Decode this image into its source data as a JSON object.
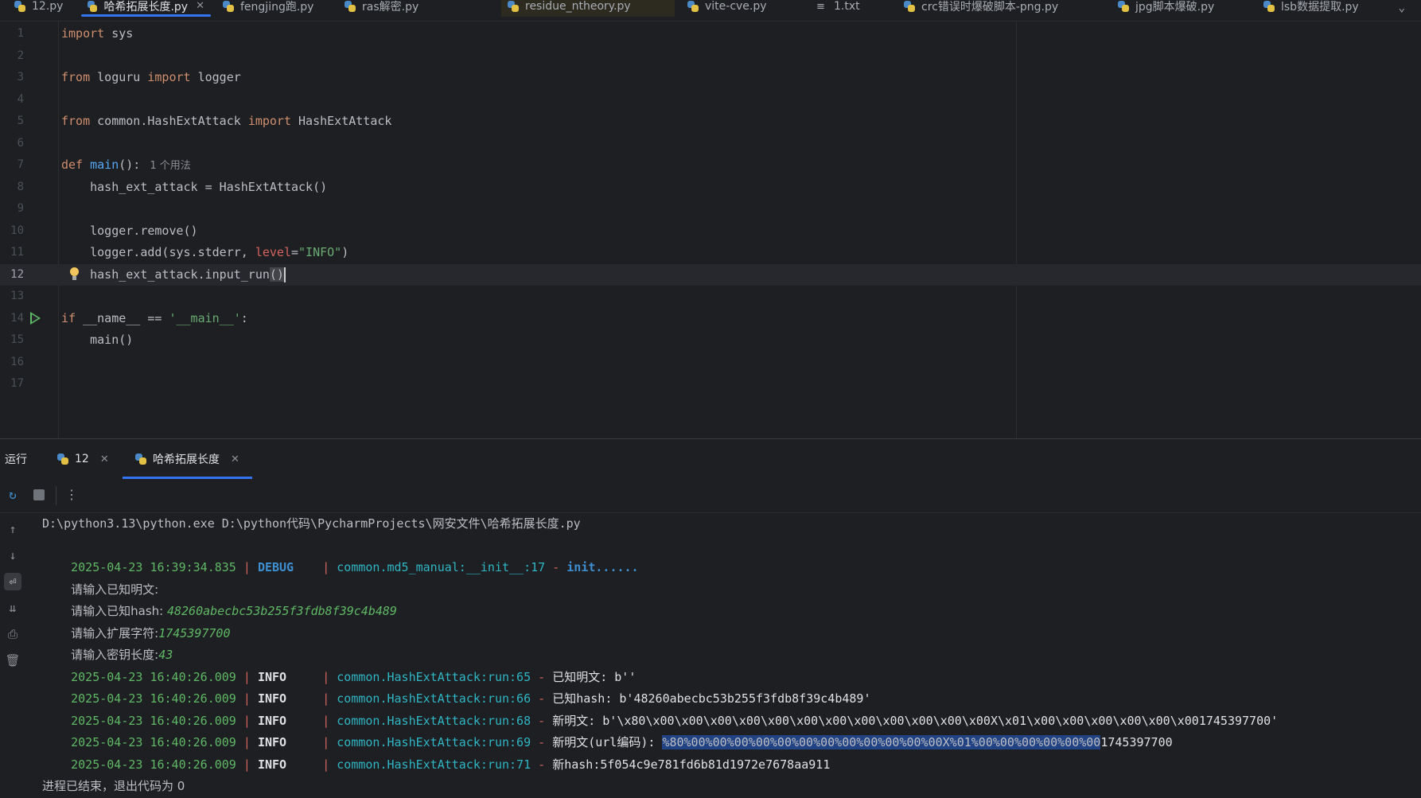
{
  "editor_tabs": [
    {
      "label": "12.py",
      "icon": "python-file-icon",
      "active": false
    },
    {
      "label": "哈希拓展长度.py",
      "icon": "python-file-icon",
      "active": true
    },
    {
      "label": "fengjing跑.py",
      "icon": "python-file-icon",
      "active": false
    },
    {
      "label": "ras解密.py",
      "icon": "python-file-icon",
      "active": false
    },
    {
      "label": "residue_ntheory.py",
      "icon": "python-file-icon",
      "active": false
    },
    {
      "label": "vite-cve.py",
      "icon": "python-file-icon",
      "active": false
    },
    {
      "label": "1.txt",
      "icon": "text-file-icon",
      "active": false
    },
    {
      "label": "crc错误时爆破脚本-png.py",
      "icon": "python-file-icon",
      "active": false
    },
    {
      "label": "jpg脚本爆破.py",
      "icon": "python-file-icon",
      "active": false
    },
    {
      "label": "lsb数据提取.py",
      "icon": "python-file-icon",
      "active": false
    }
  ],
  "editor": {
    "line_numbers": [
      "1",
      "2",
      "3",
      "4",
      "5",
      "6",
      "7",
      "8",
      "9",
      "10",
      "11",
      "12",
      "13",
      "14",
      "15",
      "16",
      "17"
    ],
    "current_line": 12,
    "code": {
      "l1_kw": "import",
      "l1_rest": " sys",
      "l3_kw1": "from",
      "l3_mid": " loguru ",
      "l3_kw2": "import",
      "l3_rest": " logger",
      "l5_kw1": "from",
      "l5_mid": " common.HashExtAttack ",
      "l5_kw2": "import",
      "l5_rest": " HashExtAttack",
      "l7_kw": "def",
      "l7_fn": "main",
      "l7_rest": "():",
      "l7_hint": "1 个用法",
      "l8": "    hash_ext_attack = HashExtAttack()",
      "l10": "    logger.remove()",
      "l11_a": "    logger.add(sys.stderr, ",
      "l11_param": "level",
      "l11_eq": "=",
      "l11_str": "\"INFO\"",
      "l11_end": ")",
      "l12_a": "    hash_ext_attack.input_run",
      "l12_br": "()",
      "l14_kw": "if",
      "l14_a": " __name__ == ",
      "l14_str": "'__main__'",
      "l14_end": ":",
      "l15": "    main()"
    }
  },
  "run_panel": {
    "title": "运行",
    "tabs": [
      {
        "label": "12",
        "active": false
      },
      {
        "label": "哈希拓展长度",
        "active": true
      }
    ],
    "console": {
      "cmd": "D:\\python3.13\\python.exe D:\\python代码\\PycharmProjects\\网安文件\\哈希拓展长度.py",
      "debug_line": {
        "ts": "2025-04-23 16:39:34.835",
        "sep1": " | ",
        "level": "DEBUG   ",
        "sep2": " | ",
        "module": "common.md5_manual:__init__:17",
        "dash": " - ",
        "msg": "init......"
      },
      "prompts": [
        {
          "label": "请输入已知明文:",
          "value": ""
        },
        {
          "label": "请输入已知hash: ",
          "value": "48260abecbc53b255f3fdb8f39c4b489"
        },
        {
          "label": "请输入扩展字符:",
          "value": "1745397700"
        },
        {
          "label": "请输入密钥长度:",
          "value": "43"
        }
      ],
      "info_lines": [
        {
          "ts": "2025-04-23 16:40:26.009",
          "level": "INFO    ",
          "module": "common.HashExtAttack:run:65",
          "msg": "已知明文: b''"
        },
        {
          "ts": "2025-04-23 16:40:26.009",
          "level": "INFO    ",
          "module": "common.HashExtAttack:run:66",
          "msg": "已知hash: b'48260abecbc53b255f3fdb8f39c4b489'"
        },
        {
          "ts": "2025-04-23 16:40:26.009",
          "level": "INFO    ",
          "module": "common.HashExtAttack:run:68",
          "msg": "新明文: b'\\x80\\x00\\x00\\x00\\x00\\x00\\x00\\x00\\x00\\x00\\x00\\x00\\x00X\\x01\\x00\\x00\\x00\\x00\\x00\\x001745397700'"
        },
        {
          "ts": "2025-04-23 16:40:26.009",
          "level": "INFO    ",
          "module": "common.HashExtAttack:run:69",
          "msg_prefix": "新明文(url编码): ",
          "msg_selected": "%80%00%00%00%00%00%00%00%00%00%00%00%00X%01%00%00%00%00%00%00",
          "msg_suffix": "1745397700"
        },
        {
          "ts": "2025-04-23 16:40:26.009",
          "level": "INFO    ",
          "module": "common.HashExtAttack:run:71",
          "msg": "新hash:5f054c9e781fd6b81d1972e7678aa911"
        }
      ],
      "exit_line": "进程已结束，退出代码为 0"
    }
  },
  "colors": {
    "background": "#1e1f22",
    "accent": "#3574f0",
    "keyword": "#cf8e6d",
    "function": "#56a8f5",
    "string": "#6aab73",
    "timestamp": "#5fb865",
    "module": "#2fb5c4"
  }
}
